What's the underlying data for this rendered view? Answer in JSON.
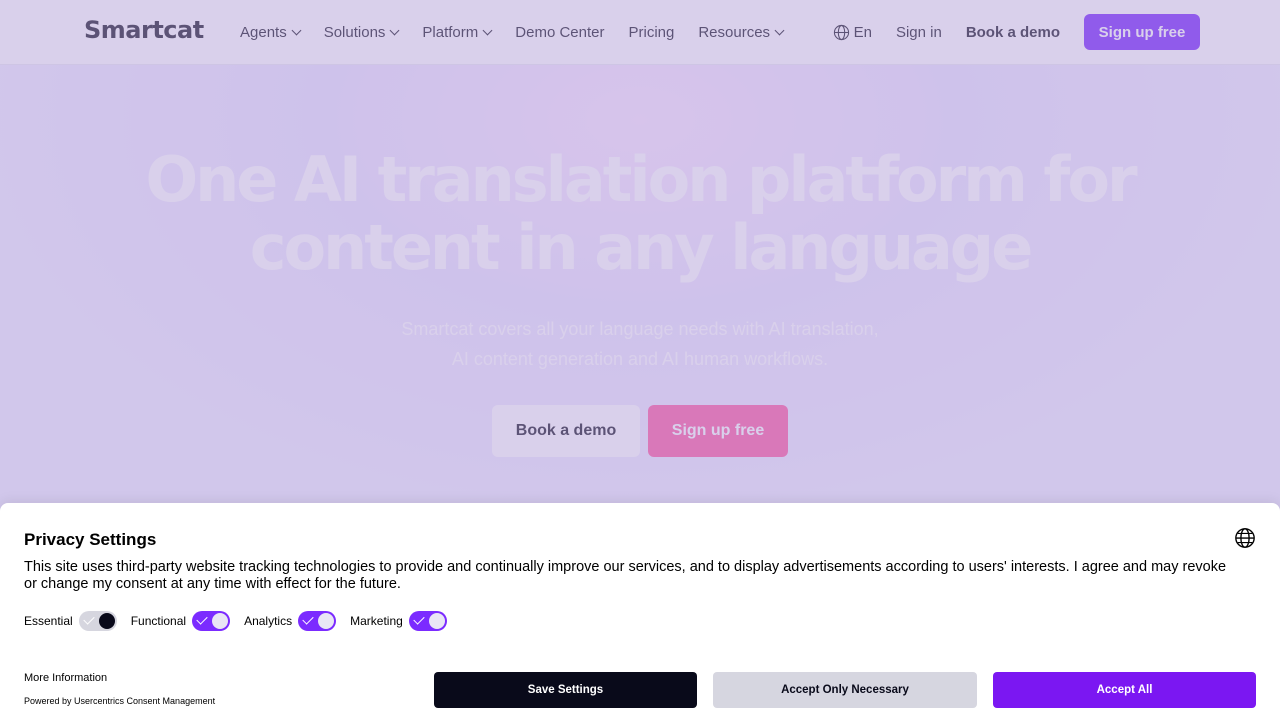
{
  "header": {
    "logo": "Smartcat",
    "nav": [
      {
        "label": "Agents",
        "dropdown": true
      },
      {
        "label": "Solutions",
        "dropdown": true
      },
      {
        "label": "Platform",
        "dropdown": true
      },
      {
        "label": "Demo Center",
        "dropdown": false
      },
      {
        "label": "Pricing",
        "dropdown": false
      },
      {
        "label": "Resources",
        "dropdown": true
      }
    ],
    "language": "En",
    "sign_in": "Sign in",
    "book_demo": "Book a demo",
    "sign_up": "Sign up free"
  },
  "hero": {
    "title_line1": "One AI translation platform for",
    "title_line2": "content in any language",
    "subtitle_line1": "Smartcat covers all your language needs with AI translation,",
    "subtitle_line2": "AI content generation and AI human workflows.",
    "book_demo": "Book a demo",
    "sign_up": "Sign up free"
  },
  "consent": {
    "title": "Privacy Settings",
    "text": "This site uses third-party website tracking technologies to provide and continually improve our services, and to display advertisements according to users' interests. I agree and may revoke or change my consent at any time with effect for the future.",
    "toggles": [
      {
        "label": "Essential",
        "state": "locked"
      },
      {
        "label": "Functional",
        "state": "on"
      },
      {
        "label": "Analytics",
        "state": "on"
      },
      {
        "label": "Marketing",
        "state": "on"
      }
    ],
    "more_info": "More Information",
    "powered_by": "Powered by Usercentrics Consent Management",
    "save_settings": "Save Settings",
    "accept_necessary": "Accept Only Necessary",
    "accept_all": "Accept All"
  },
  "colors": {
    "accent": "#7b2bff",
    "accept_all": "#7b17f2",
    "save_button": "#090a1a",
    "hero_signup": "#ff5fa5"
  }
}
